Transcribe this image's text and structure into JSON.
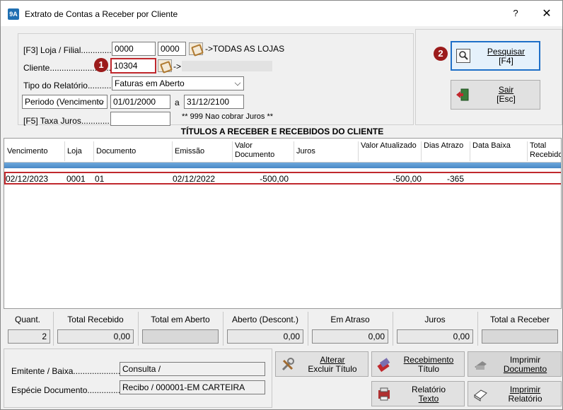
{
  "window": {
    "title": "Extrato de Contas a Receber por Cliente",
    "help_label": "?",
    "close_label": "✕",
    "app_icon_label": "9A"
  },
  "filters": {
    "loja_label": "[F3] Loja / Filial..............",
    "loja_from": "0000",
    "loja_to": "0000",
    "loja_hint": "->TODAS AS LOJAS",
    "cliente_label": "Cliente.............................",
    "cliente_value": "10304",
    "cliente_hint": "->",
    "tipo_label": "Tipo do Relatório...............",
    "tipo_value": "Faturas em Aberto",
    "periodo_select": "Periodo (Vencimento",
    "periodo_from": "01/01/2000",
    "periodo_sep": "a",
    "periodo_to": "31/12/2100",
    "taxa_label": "[F5] Taxa Juros...............",
    "taxa_value": "",
    "juros_note": "** 999 Nao cobrar Juros **"
  },
  "annotations": {
    "badge1": "1",
    "badge2": "2"
  },
  "buttons": {
    "pesquisar_line1": "Pesquisar",
    "pesquisar_line2": "[F4]",
    "sair_line1": "Sair",
    "sair_line2": "[Esc]"
  },
  "grid": {
    "title": "TÍTULOS A RECEBER E RECEBIDOS DO CLIENTE",
    "headers": [
      "Vencimento",
      "Loja",
      "Documento",
      "Emissão",
      "Valor Documento",
      "Juros",
      "Valor Atualizado",
      "Dias Atrazo",
      "Data Baixa",
      "Total Recebido"
    ],
    "rows": [
      {
        "vencimento": "02/12/2023",
        "loja": "0001",
        "documento": "01",
        "emissao": "02/12/2022",
        "valor_documento": "-500,00",
        "juros": "",
        "valor_atualizado": "-500,00",
        "dias_atrazo": "-365",
        "data_baixa": "",
        "total_recebido": ""
      }
    ]
  },
  "totals": {
    "quant_label": "Quant.",
    "quant_value": "2",
    "total_recebido_label": "Total Recebido",
    "total_recebido_value": "0,00",
    "total_aberto_label": "Total em Aberto",
    "total_aberto_value": "",
    "aberto_descont_label": "Aberto (Descont.)",
    "aberto_descont_value": "0,00",
    "em_atraso_label": "Em Atraso",
    "em_atraso_value": "0,00",
    "juros_label": "Juros",
    "juros_value": "0,00",
    "total_receber_label": "Total a Receber",
    "total_receber_value": ""
  },
  "info": {
    "emitente_label": "Emitente / Baixa......................",
    "emitente_value": "Consulta /",
    "especie_label": "Espécie Documento...............",
    "especie_value": "Recibo   /   000001-EM CARTEIRA"
  },
  "actions": {
    "alterar_line1": "Alterar",
    "alterar_line2": "Excluir Título",
    "recebimento_line1": "Recebimento",
    "recebimento_line2": "Título",
    "imprimir_doc_line1": "Imprimir",
    "imprimir_doc_line2": "Documento",
    "relatorio_texto_line1": "Relatório",
    "relatorio_texto_line2": "Texto",
    "imprimir_rel_line1": "Imprimir",
    "imprimir_rel_line2": "Relatório"
  },
  "colors": {
    "highlight": "#c0282d",
    "badge": "#9b1b1b",
    "band": "#5b97d0",
    "focus": "#1e6fc8"
  }
}
